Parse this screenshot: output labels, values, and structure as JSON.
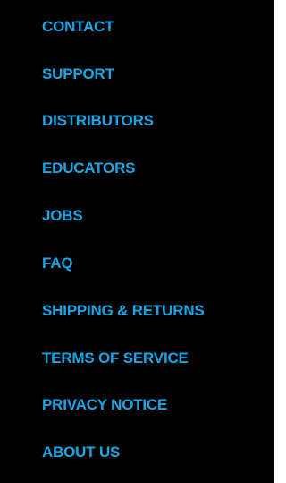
{
  "colors": {
    "background": "#000000",
    "link": "#1aa6e6"
  },
  "menu": {
    "items": [
      {
        "label": "CONTACT"
      },
      {
        "label": "SUPPORT"
      },
      {
        "label": "DISTRIBUTORS"
      },
      {
        "label": "EDUCATORS"
      },
      {
        "label": "JOBS"
      },
      {
        "label": "FAQ"
      },
      {
        "label": "SHIPPING & RETURNS"
      },
      {
        "label": "TERMS OF SERVICE"
      },
      {
        "label": "PRIVACY NOTICE"
      },
      {
        "label": "ABOUT US"
      }
    ]
  }
}
